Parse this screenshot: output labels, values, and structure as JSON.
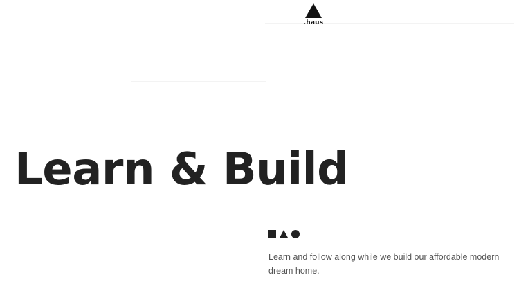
{
  "header": {
    "logo_text": ".haus",
    "logo_icon": "triangle-logo-icon"
  },
  "hero": {
    "title": "Learn & Build",
    "shapes": [
      "square-icon",
      "triangle-icon",
      "circle-icon"
    ],
    "description": "Learn and follow along while we build our affordable modern dream home."
  },
  "colors": {
    "text": "#222222",
    "logo": "#111111",
    "body_text": "#555555",
    "background": "#ffffff"
  }
}
